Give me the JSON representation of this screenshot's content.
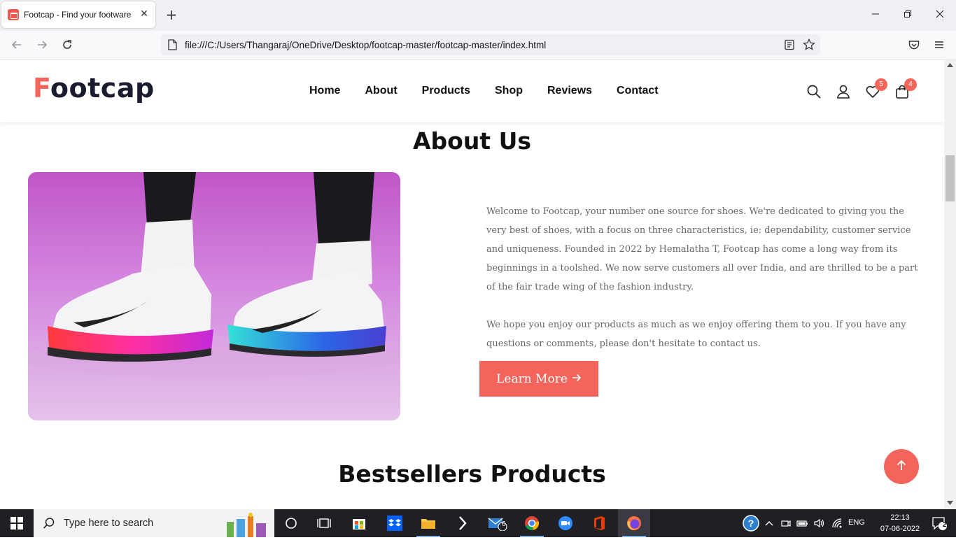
{
  "browser": {
    "tab_title": "Footcap - Find your footware",
    "url": "file:///C:/Users/Thangaraj/OneDrive/Desktop/footcap-master/footcap-master/index.html"
  },
  "site": {
    "logo_first": "F",
    "logo_rest": "ootcap",
    "nav": [
      "Home",
      "About",
      "Products",
      "Shop",
      "Reviews",
      "Contact"
    ],
    "wishlist_count": "5",
    "cart_count": "4"
  },
  "about": {
    "title": "About Us",
    "paragraph1": "Welcome to Footcap, your number one source for shoes. We're dedicated to giving you the very best of shoes, with a focus on three characteristics, ie: dependability, customer service and uniqueness. Founded in 2022 by Hemalatha T, Footcap has come a long way from its beginnings in a toolshed. We now serve customers all over India, and are thrilled to be a part of the fair trade wing of the fashion industry.",
    "paragraph2": "We hope you enjoy our products as much as we enjoy offering them to you. If you have any questions or comments, please don't hesitate to contact us.",
    "button": "Learn More"
  },
  "bestsellers": {
    "title": "Bestsellers Products"
  },
  "taskbar": {
    "search_placeholder": "Type here to search",
    "mail_badge": "6",
    "language": "ENG",
    "time": "22:13",
    "date": "07-06-2022",
    "notification_count": "2"
  },
  "colors": {
    "accent": "#f3645a",
    "heading": "#111111",
    "body_text": "#666666"
  }
}
